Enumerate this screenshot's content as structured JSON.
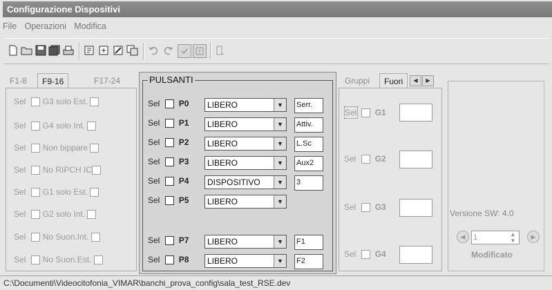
{
  "window": {
    "title": "Configurazione Dispositivi"
  },
  "menu": [
    "File",
    "Operazioni",
    "Modifica"
  ],
  "toolbar": {
    "icons": [
      "new-file-icon",
      "open-folder-icon",
      "save-icon",
      "save-all-icon",
      "print-icon",
      "import-icon",
      "export-icon",
      "edit-icon",
      "copy-icon",
      "undo-icon",
      "redo-icon",
      "check-icon",
      "window-icon",
      "exit-icon"
    ]
  },
  "left_panel": {
    "tabs": [
      "F1-8",
      "F9-16",
      "F17-24"
    ],
    "active_tab": "F9-16",
    "rows": [
      {
        "sel": "Sel",
        "label": "G3 solo Est."
      },
      {
        "sel": "Sel",
        "label": "G4 solo Int."
      },
      {
        "sel": "Sel",
        "label": "Non bippare"
      },
      {
        "sel": "Sel",
        "label": "No RIPCH IC"
      },
      {
        "sel": "Sel",
        "label": "G1 solo Est."
      },
      {
        "sel": "Sel",
        "label": "G2 solo Int."
      },
      {
        "sel": "Sel",
        "label": "No Suon.Int."
      },
      {
        "sel": "Sel",
        "label": "No Suon.Est."
      }
    ]
  },
  "pulsanti": {
    "title": "PULSANTI",
    "rows": [
      {
        "sel": "Sel",
        "id": "P0",
        "combo": "LIBERO",
        "text": "Serr."
      },
      {
        "sel": "Sel",
        "id": "P1",
        "combo": "LIBERO",
        "text": "Attiv."
      },
      {
        "sel": "Sel",
        "id": "P2",
        "combo": "LIBERO",
        "text": "L.Sc"
      },
      {
        "sel": "Sel",
        "id": "P3",
        "combo": "LIBERO",
        "text": "Aux2"
      },
      {
        "sel": "Sel",
        "id": "P4",
        "combo": "DISPOSITIVO",
        "text": "3"
      },
      {
        "sel": "Sel",
        "id": "P5",
        "combo": "LIBERO",
        "text": ""
      },
      {
        "sel": "Sel",
        "id": "P7",
        "combo": "LIBERO",
        "text": "F1"
      },
      {
        "sel": "Sel",
        "id": "P8",
        "combo": "LIBERO",
        "text": "F2"
      }
    ]
  },
  "groups_panel": {
    "tabs": [
      "Gruppi",
      "Fuori"
    ],
    "rows": [
      {
        "sel": "Sel",
        "id": "G1"
      },
      {
        "sel": "Sel",
        "id": "G2"
      },
      {
        "sel": "Sel",
        "id": "G3"
      },
      {
        "sel": "Sel",
        "id": "G4"
      }
    ]
  },
  "version_panel": {
    "version": "Versione SW: 4.0",
    "spinner_value": "1",
    "status": "Modificato"
  },
  "statusbar": {
    "path": "C:\\Documenti\\Videocitofonia_VIMAR\\banchi_prova_config\\sala_test_RSE.dev"
  }
}
